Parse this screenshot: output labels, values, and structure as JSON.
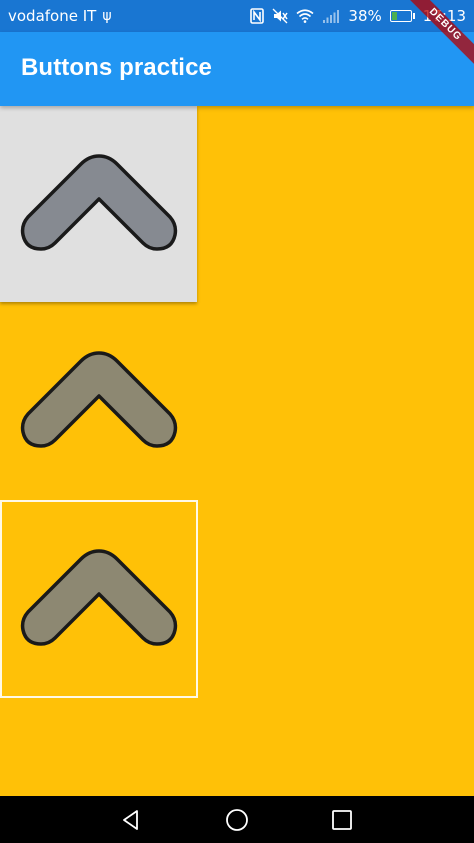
{
  "status_bar": {
    "carrier": "vodafone IT",
    "usb_glyph": "ψ",
    "battery_percent": "38%",
    "battery_level": 0.38,
    "time": "17:13",
    "icons": [
      "nfc-icon",
      "mute-icon",
      "wifi-icon",
      "signal-icon",
      "battery-icon"
    ]
  },
  "app_bar": {
    "title": "Buttons practice"
  },
  "debug_banner": {
    "label": "DEBUG"
  },
  "buttons": [
    {
      "kind": "raised",
      "icon": "chevron-up-icon",
      "icon_fill": "#868a91"
    },
    {
      "kind": "flat",
      "icon": "chevron-up-icon",
      "icon_fill": "#8d8872"
    },
    {
      "kind": "outline",
      "icon": "chevron-up-icon",
      "icon_fill": "#8d8872"
    }
  ],
  "nav_bar": {
    "items": [
      "back-icon",
      "home-icon",
      "recents-icon"
    ]
  },
  "colors": {
    "status_bar": "#1976D2",
    "app_bar": "#2196F3",
    "background": "#FFC107",
    "raised_button": "#E0E0E0"
  }
}
